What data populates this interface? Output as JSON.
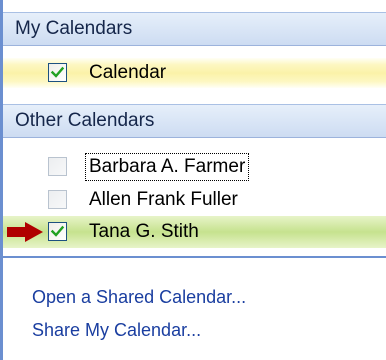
{
  "my_calendars": {
    "header": "My Calendars",
    "items": [
      {
        "label": "Calendar",
        "checked": true
      }
    ]
  },
  "other_calendars": {
    "header": "Other Calendars",
    "items": [
      {
        "label": "Barbara A. Farmer",
        "checked": false,
        "focused": true
      },
      {
        "label": "Allen Frank Fuller",
        "checked": false
      },
      {
        "label": "Tana G. Stith",
        "checked": true,
        "highlighted": true,
        "pointer_arrow": true
      }
    ]
  },
  "links": {
    "open_shared": "Open a Shared Calendar...",
    "share_my": "Share My Calendar..."
  },
  "colors": {
    "header_text": "#15264a",
    "link": "#1a3ea0",
    "checkmark": "#21a121",
    "arrow": "#b00000",
    "selected_row": "#c6e28e",
    "yellow_row": "#fbf2a8",
    "accent_border": "#6b8fd0"
  },
  "icons": {
    "checkbox_checked": "checkbox-checked-icon",
    "checkbox_unchecked": "checkbox-unchecked-icon",
    "pointer_arrow": "red-arrow-icon"
  }
}
